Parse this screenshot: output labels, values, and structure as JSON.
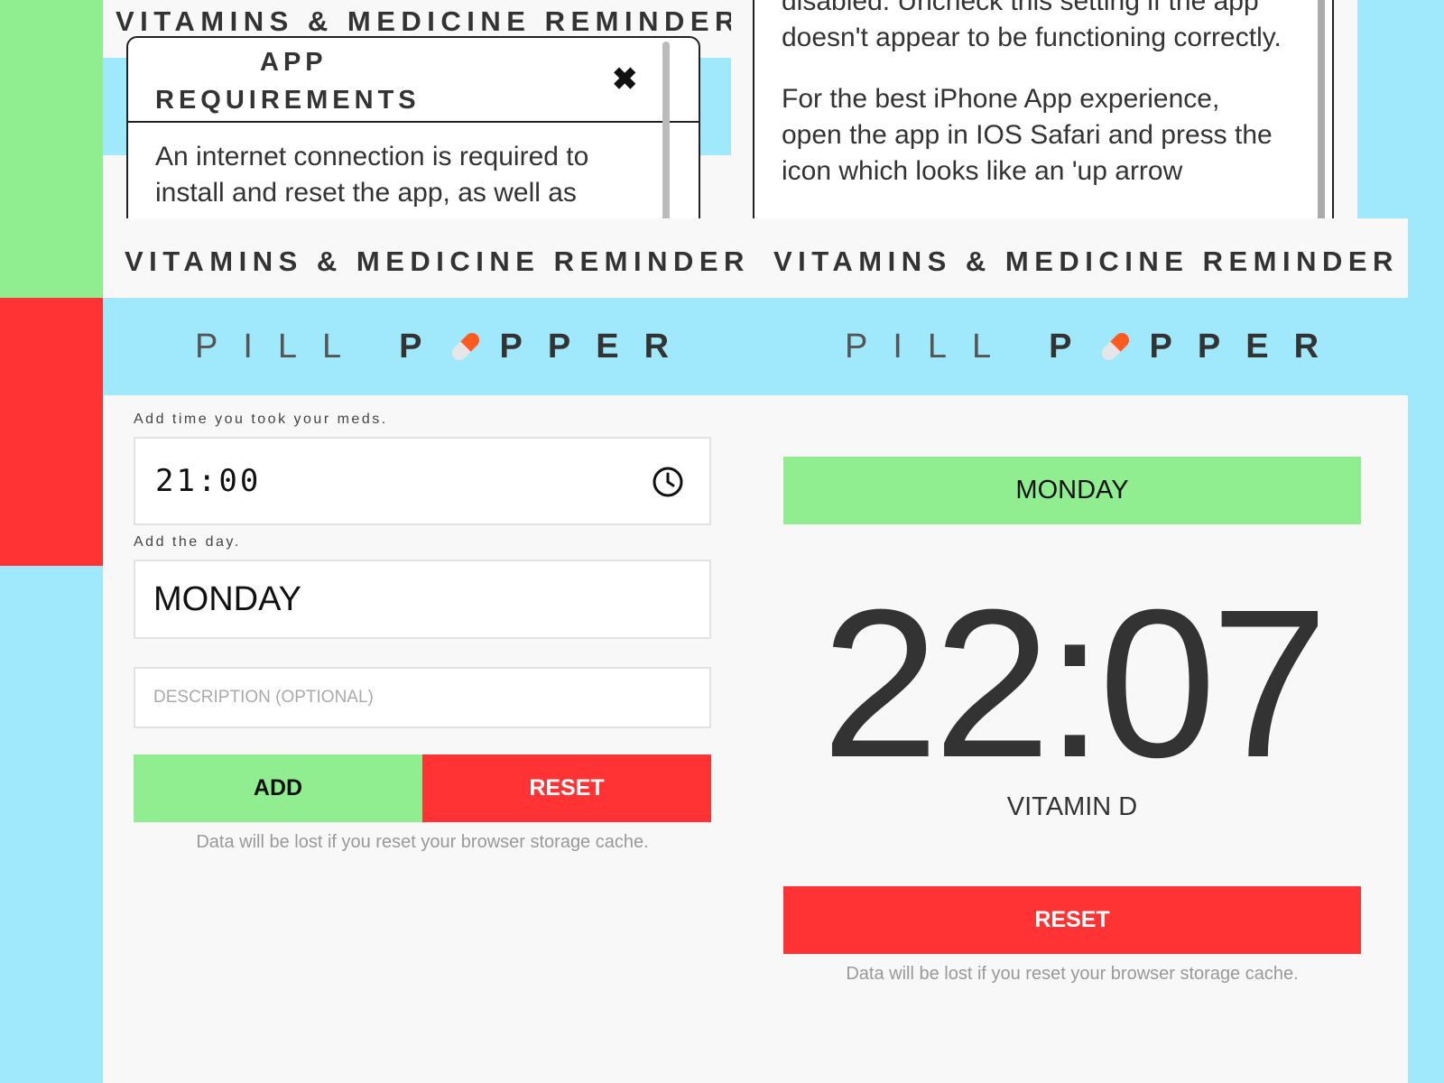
{
  "app": {
    "title": "VITAMINS & MEDICINE REMINDER",
    "logo": {
      "word1": "PILL",
      "word2_start": "P",
      "word2_end": "PPER"
    }
  },
  "modal": {
    "title_line1": "APP",
    "title_line2": "REQUIREMENTS",
    "close_glyph": "✖",
    "body": "An internet connection is required to install and reset the app, as well as"
  },
  "info_card": {
    "para1": "disabled. Uncheck this setting if the app doesn't appear to be functioning correctly.",
    "para2": "For the best iPhone App experience, open the app in IOS Safari and press the icon which looks like an 'up arrow"
  },
  "form": {
    "time_label": "Add time you took your meds.",
    "time_value": "21:00",
    "day_label": "Add the day.",
    "day_value": "MONDAY",
    "description_placeholder": "DESCRIPTION (OPTIONAL)",
    "add_label": "ADD",
    "reset_label": "RESET",
    "note": "Data will be lost if you reset your browser storage cache."
  },
  "reminder": {
    "day": "MONDAY",
    "time": "22:07",
    "medicine": "VITAMIN D",
    "reset_label": "RESET",
    "note": "Data will be lost if you reset your browser storage cache."
  },
  "colors": {
    "green": "#90ee90",
    "red": "#ff3333",
    "sky_blue": "#a0e9fd",
    "capsule_orange": "#ff5a1f"
  }
}
